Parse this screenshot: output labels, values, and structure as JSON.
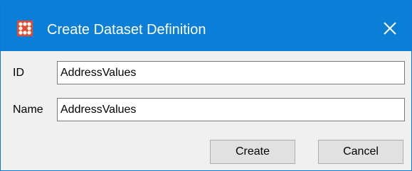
{
  "window": {
    "title": "Create Dataset Definition",
    "icon": "app-grid-icon",
    "close_icon": "close-icon",
    "accent_color": "#0b7fd8",
    "icon_color": "#e54c2e"
  },
  "form": {
    "id_label": "ID",
    "id_value": "AddressValues",
    "name_label": "Name",
    "name_value": "AddressValues"
  },
  "buttons": {
    "create_label": "Create",
    "cancel_label": "Cancel"
  }
}
